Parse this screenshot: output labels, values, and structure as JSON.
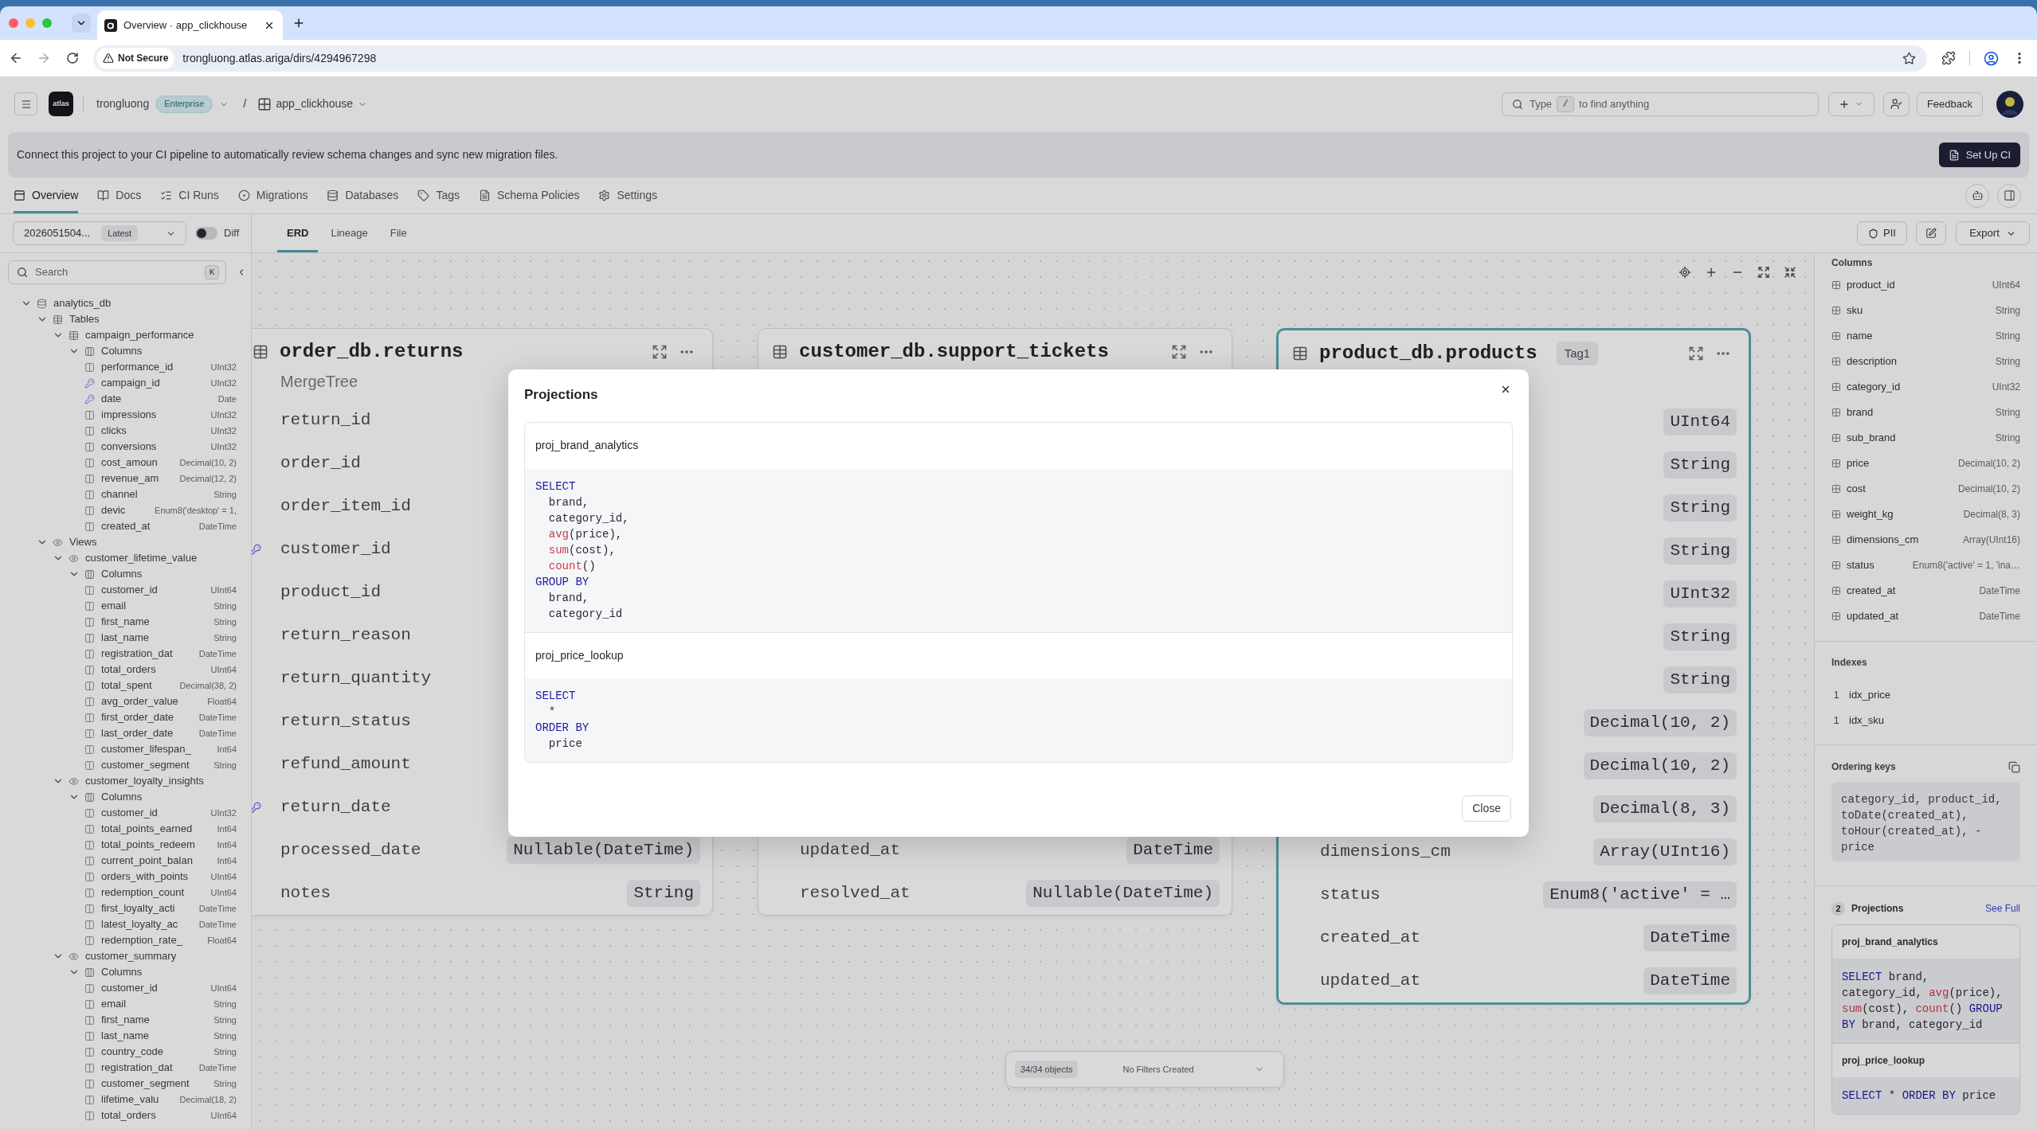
{
  "browser": {
    "tabs": [
      {
        "title": "Overview · app_clickhouse",
        "selected": true
      }
    ],
    "security": "Not Secure",
    "url": "trongluong.atlas.ariga/dirs/4294967298"
  },
  "header": {
    "logo_text": "atlas",
    "org": "trongluong",
    "plan": "Enterprise",
    "separator": "/",
    "project": "app_clickhouse",
    "search": {
      "placeholder": "Type",
      "key": "/",
      "placeholder_after": "to find anything"
    },
    "feedback": "Feedback"
  },
  "banner": {
    "text": "Connect this project to your CI pipeline to automatically review schema changes and sync new migration files.",
    "button": "Set Up CI"
  },
  "nav_tabs": [
    {
      "label": "Overview",
      "kind": "overview",
      "selected": true
    },
    {
      "label": "Docs",
      "kind": "docs",
      "selected": false
    },
    {
      "label": "CI Runs",
      "kind": "ci_runs",
      "selected": false
    },
    {
      "label": "Migrations",
      "kind": "migrations",
      "selected": false
    },
    {
      "label": "Databases",
      "kind": "databases",
      "selected": false
    },
    {
      "label": "Tags",
      "kind": "tags",
      "selected": false
    },
    {
      "label": "Schema Policies",
      "kind": "policies",
      "selected": false
    },
    {
      "label": "Settings",
      "kind": "settings",
      "selected": false
    }
  ],
  "toolbar": {
    "version": "2026051504...",
    "version_badge": "Latest",
    "diff": {
      "label": "Diff",
      "on": false
    },
    "view_tabs": [
      {
        "label": "ERD",
        "selected": true
      },
      {
        "label": "Lineage",
        "selected": false
      },
      {
        "label": "File",
        "selected": false
      }
    ],
    "pii": "PII",
    "export": "Export"
  },
  "sidebar": {
    "search": {
      "placeholder": "Search",
      "key": "K"
    },
    "tree": [
      {
        "label": "analytics_db",
        "kind": "database",
        "expanded": true,
        "children": [
          {
            "label": "Tables",
            "kind": "tables",
            "expanded": true,
            "children": [
              {
                "label": "campaign_performance",
                "kind": "table",
                "expanded": true,
                "children": [
                  {
                    "label": "Columns",
                    "kind": "columns",
                    "expanded": true,
                    "children": [
                      {
                        "label": "performance_id",
                        "kind": "column",
                        "type": "UInt32"
                      },
                      {
                        "label": "campaign_id",
                        "kind": "key_column",
                        "type": "UInt32"
                      },
                      {
                        "label": "date",
                        "kind": "key_column",
                        "type": "Date"
                      },
                      {
                        "label": "impressions",
                        "kind": "column",
                        "type": "UInt32"
                      },
                      {
                        "label": "clicks",
                        "kind": "column",
                        "type": "UInt32"
                      },
                      {
                        "label": "conversions",
                        "kind": "column",
                        "type": "UInt32"
                      },
                      {
                        "label": "cost_amoun",
                        "kind": "column",
                        "type": "Decimal(10, 2)"
                      },
                      {
                        "label": "revenue_am",
                        "kind": "column",
                        "type": "Decimal(12, 2)"
                      },
                      {
                        "label": "channel",
                        "kind": "column",
                        "type": "String"
                      },
                      {
                        "label": "devic",
                        "kind": "column",
                        "type": "Enum8('desktop' = 1,"
                      },
                      {
                        "label": "created_at",
                        "kind": "column",
                        "type": "DateTime"
                      }
                    ]
                  }
                ]
              }
            ]
          },
          {
            "label": "Views",
            "kind": "views",
            "expanded": true,
            "children": [
              {
                "label": "customer_lifetime_value",
                "kind": "view",
                "expanded": true,
                "children": [
                  {
                    "label": "Columns",
                    "kind": "columns",
                    "expanded": true,
                    "children": [
                      {
                        "label": "customer_id",
                        "kind": "column",
                        "type": "UInt64"
                      },
                      {
                        "label": "email",
                        "kind": "column",
                        "type": "String"
                      },
                      {
                        "label": "first_name",
                        "kind": "column",
                        "type": "String"
                      },
                      {
                        "label": "last_name",
                        "kind": "column",
                        "type": "String"
                      },
                      {
                        "label": "registration_dat",
                        "kind": "column",
                        "type": "DateTime"
                      },
                      {
                        "label": "total_orders",
                        "kind": "column",
                        "type": "UInt64"
                      },
                      {
                        "label": "total_spent",
                        "kind": "column",
                        "type": "Decimal(38, 2)"
                      },
                      {
                        "label": "avg_order_value",
                        "kind": "column",
                        "type": "Float64"
                      },
                      {
                        "label": "first_order_date",
                        "kind": "column",
                        "type": "DateTime"
                      },
                      {
                        "label": "last_order_date",
                        "kind": "column",
                        "type": "DateTime"
                      },
                      {
                        "label": "customer_lifespan_",
                        "kind": "column",
                        "type": "Int64"
                      },
                      {
                        "label": "customer_segment",
                        "kind": "column",
                        "type": "String"
                      }
                    ]
                  }
                ]
              },
              {
                "label": "customer_loyalty_insights",
                "kind": "view",
                "expanded": true,
                "children": [
                  {
                    "label": "Columns",
                    "kind": "columns",
                    "expanded": true,
                    "children": [
                      {
                        "label": "customer_id",
                        "kind": "column",
                        "type": "UInt32"
                      },
                      {
                        "label": "total_points_earned",
                        "kind": "column",
                        "type": "Int64"
                      },
                      {
                        "label": "total_points_redeem",
                        "kind": "column",
                        "type": "Int64"
                      },
                      {
                        "label": "current_point_balan",
                        "kind": "column",
                        "type": "Int64"
                      },
                      {
                        "label": "orders_with_points",
                        "kind": "column",
                        "type": "UInt64"
                      },
                      {
                        "label": "redemption_count",
                        "kind": "column",
                        "type": "UInt64"
                      },
                      {
                        "label": "first_loyalty_acti",
                        "kind": "column",
                        "type": "DateTime"
                      },
                      {
                        "label": "latest_loyalty_ac",
                        "kind": "column",
                        "type": "DateTime"
                      },
                      {
                        "label": "redemption_rate_",
                        "kind": "column",
                        "type": "Float64"
                      }
                    ]
                  }
                ]
              },
              {
                "label": "customer_summary",
                "kind": "view",
                "expanded": true,
                "children": [
                  {
                    "label": "Columns",
                    "kind": "columns",
                    "expanded": true,
                    "children": [
                      {
                        "label": "customer_id",
                        "kind": "column",
                        "type": "UInt64"
                      },
                      {
                        "label": "email",
                        "kind": "column",
                        "type": "String"
                      },
                      {
                        "label": "first_name",
                        "kind": "column",
                        "type": "String"
                      },
                      {
                        "label": "last_name",
                        "kind": "column",
                        "type": "String"
                      },
                      {
                        "label": "country_code",
                        "kind": "column",
                        "type": "String"
                      },
                      {
                        "label": "registration_dat",
                        "kind": "column",
                        "type": "DateTime"
                      },
                      {
                        "label": "customer_segment",
                        "kind": "column",
                        "type": "String"
                      },
                      {
                        "label": "lifetime_valu",
                        "kind": "column",
                        "type": "Decimal(18, 2)"
                      },
                      {
                        "label": "total_orders",
                        "kind": "column",
                        "type": "UInt64"
                      }
                    ]
                  }
                ]
              }
            ]
          }
        ]
      }
    ]
  },
  "canvas": {
    "tables": [
      {
        "title": "order_db.returns",
        "engine": "MergeTree",
        "selected": false,
        "rows": [
          {
            "name": "return_id",
            "key": false
          },
          {
            "name": "order_id",
            "key": false
          },
          {
            "name": "order_item_id",
            "key": false
          },
          {
            "name": "customer_id",
            "key": true
          },
          {
            "name": "product_id",
            "key": false
          },
          {
            "name": "return_reason",
            "key": false
          },
          {
            "name": "return_quantity",
            "key": false
          },
          {
            "name": "return_status",
            "key": false
          },
          {
            "name": "refund_amount",
            "key": false
          },
          {
            "name": "return_date",
            "key": true
          },
          {
            "name": "processed_date",
            "type": "Nullable(DateTime)",
            "key": false
          },
          {
            "name": "notes",
            "type": "String",
            "key": false
          }
        ]
      },
      {
        "title": "customer_db.support_tickets",
        "selected": false,
        "rows": [
          {
            "name": "updated_at",
            "type": "DateTime",
            "key": false
          },
          {
            "name": "resolved_at",
            "type": "Nullable(DateTime)",
            "key": false
          }
        ]
      },
      {
        "title": "product_db.products",
        "tag": "Tag1",
        "selected": true,
        "rows": [
          {
            "type": "UInt64"
          },
          {
            "type": "String"
          },
          {
            "type": "String"
          },
          {
            "type": "String"
          },
          {
            "type": "UInt32"
          },
          {
            "type": "String"
          },
          {
            "type": "String"
          },
          {
            "type": "Decimal(10, 2)"
          },
          {
            "type": "Decimal(10, 2)"
          },
          {
            "type": "Decimal(8, 3)"
          },
          {
            "name": "dimensions_cm",
            "type": "Array(UInt16)",
            "key": false
          },
          {
            "name": "status",
            "type": "Enum8('active' = …",
            "key": false
          },
          {
            "name": "created_at",
            "type": "DateTime",
            "key": false
          },
          {
            "name": "updated_at",
            "type": "DateTime",
            "key": false
          }
        ]
      }
    ],
    "status": {
      "count": "34/34 objects",
      "filters": "No Filters Created"
    }
  },
  "details": {
    "columns_heading": "Columns",
    "columns": [
      {
        "name": "product_id",
        "type": "UInt64"
      },
      {
        "name": "sku",
        "type": "String"
      },
      {
        "name": "name",
        "type": "String"
      },
      {
        "name": "description",
        "type": "String"
      },
      {
        "name": "category_id",
        "type": "UInt32"
      },
      {
        "name": "brand",
        "type": "String"
      },
      {
        "name": "sub_brand",
        "type": "String"
      },
      {
        "name": "price",
        "type": "Decimal(10, 2)"
      },
      {
        "name": "cost",
        "type": "Decimal(10, 2)"
      },
      {
        "name": "weight_kg",
        "type": "Decimal(8, 3)"
      },
      {
        "name": "dimensions_cm",
        "type": "Array(UInt16)"
      },
      {
        "name": "status",
        "type": "Enum8('active' = 1, 'ina…"
      },
      {
        "name": "created_at",
        "type": "DateTime"
      },
      {
        "name": "updated_at",
        "type": "DateTime"
      }
    ],
    "indexes_heading": "Indexes",
    "indexes": [
      {
        "number": "1",
        "name": "idx_price"
      },
      {
        "number": "1",
        "name": "idx_sku"
      }
    ],
    "ordering_heading": "Ordering keys",
    "ordering_keys": "category_id, product_id, toDate(created_at), toHour(created_at), -price",
    "projections_count": "2",
    "projections_heading": "Projections",
    "see_full": "See Full",
    "projections": [
      {
        "name": "proj_brand_analytics",
        "code": [
          {
            "kind": "keyword",
            "text": "SELECT"
          },
          {
            "kind": "plain",
            "text": " brand, category_id, "
          },
          {
            "kind": "function",
            "text": "avg"
          },
          {
            "kind": "plain",
            "text": "(price), "
          },
          {
            "kind": "function",
            "text": "sum"
          },
          {
            "kind": "plain",
            "text": "(cost), "
          },
          {
            "kind": "function",
            "text": "count"
          },
          {
            "kind": "plain",
            "text": "() "
          },
          {
            "kind": "keyword",
            "text": "GROUP BY"
          },
          {
            "kind": "plain",
            "text": " brand, category_id"
          }
        ]
      },
      {
        "name": "proj_price_lookup",
        "code": [
          {
            "kind": "keyword",
            "text": "SELECT"
          },
          {
            "kind": "plain",
            "text": " * "
          },
          {
            "kind": "keyword",
            "text": "ORDER BY"
          },
          {
            "kind": "plain",
            "text": " price"
          }
        ]
      }
    ]
  },
  "modal": {
    "title": "Projections",
    "projections": [
      {
        "name": "proj_brand_analytics",
        "lines": [
          {
            "indented": false,
            "tokens": [
              {
                "kind": "keyword",
                "text": "SELECT"
              }
            ]
          },
          {
            "indented": true,
            "tokens": [
              {
                "kind": "plain",
                "text": "brand,"
              }
            ]
          },
          {
            "indented": true,
            "tokens": [
              {
                "kind": "plain",
                "text": "category_id,"
              }
            ]
          },
          {
            "indented": true,
            "tokens": [
              {
                "kind": "function",
                "text": "avg"
              },
              {
                "kind": "plain",
                "text": "(price),"
              }
            ]
          },
          {
            "indented": true,
            "tokens": [
              {
                "kind": "function",
                "text": "sum"
              },
              {
                "kind": "plain",
                "text": "(cost),"
              }
            ]
          },
          {
            "indented": true,
            "tokens": [
              {
                "kind": "function",
                "text": "count"
              },
              {
                "kind": "plain",
                "text": "()"
              }
            ]
          },
          {
            "indented": false,
            "tokens": [
              {
                "kind": "keyword",
                "text": "GROUP BY"
              }
            ]
          },
          {
            "indented": true,
            "tokens": [
              {
                "kind": "plain",
                "text": "brand,"
              }
            ]
          },
          {
            "indented": true,
            "tokens": [
              {
                "kind": "plain",
                "text": "category_id"
              }
            ]
          }
        ]
      },
      {
        "name": "proj_price_lookup",
        "lines": [
          {
            "indented": false,
            "tokens": [
              {
                "kind": "keyword",
                "text": "SELECT"
              }
            ]
          },
          {
            "indented": true,
            "tokens": [
              {
                "kind": "plain",
                "text": "*"
              }
            ]
          },
          {
            "indented": false,
            "tokens": [
              {
                "kind": "keyword",
                "text": "ORDER BY"
              }
            ]
          },
          {
            "indented": true,
            "tokens": [
              {
                "kind": "plain",
                "text": "price"
              }
            ]
          }
        ]
      }
    ],
    "close": "Close"
  }
}
